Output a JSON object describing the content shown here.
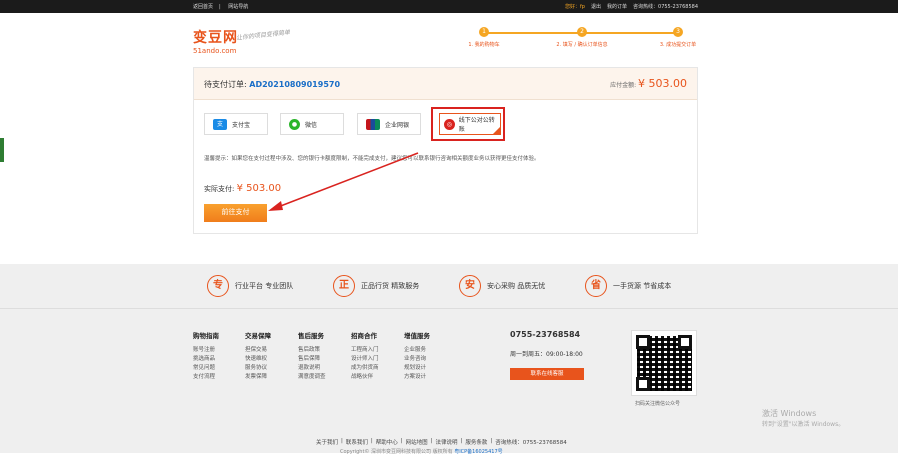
{
  "topbar": {
    "left_links": [
      "返回首页",
      "网站导航"
    ],
    "user_label": "您好：fp",
    "right_links": [
      "退出",
      "我的订单",
      "咨询热线：0755-23768584"
    ]
  },
  "logo": {
    "cn": "变豆网",
    "en": "51ando.com",
    "slogan": "让你的项目变得简单"
  },
  "steps": [
    {
      "num": "1",
      "label": "1. 我的购物车"
    },
    {
      "num": "2",
      "label": "2. 填写 / 确认订单信息"
    },
    {
      "num": "3",
      "label": "3. 成功提交订单"
    }
  ],
  "order": {
    "label": "待支付订单:",
    "order_no": "AD20210809019570",
    "amount_label": "应付金额:",
    "amount": "¥ 503.00"
  },
  "payment": {
    "methods": [
      {
        "label": "支付宝",
        "icon": "alipay-icon",
        "color": "#1a8be6"
      },
      {
        "label": "微信",
        "icon": "wechat-icon",
        "color": "#2bb52b"
      },
      {
        "label": "企业网银",
        "icon": "unionpay-icon",
        "color": "#c4161c"
      },
      {
        "label": "线下公对公转账",
        "icon": "transfer-icon",
        "color": "#d9231f"
      }
    ],
    "tip": "温馨提示：如果您在支付过程中涉及、您的银行卡额度限制，不能完成支付，建议您可以联系银行咨询相关额度业务以获得更佳支付体验。",
    "actual_label": "实际支付:",
    "actual_amount": "¥ 503.00",
    "pay_button": "前往支付"
  },
  "promos": [
    {
      "badge": "专",
      "text": "行业平台 专业团队"
    },
    {
      "badge": "正",
      "text": "正品行货 精致服务"
    },
    {
      "badge": "安",
      "text": "安心采购 品质无忧"
    },
    {
      "badge": "省",
      "text": "一手货源 节省成本"
    }
  ],
  "footer_cols": [
    {
      "title": "购物指南",
      "items": [
        "账号注册",
        "挑选商品",
        "常见问题",
        "支付流程"
      ]
    },
    {
      "title": "交易保障",
      "items": [
        "担保交易",
        "快速维权",
        "服务协议",
        "发票保障"
      ]
    },
    {
      "title": "售后服务",
      "items": [
        "售后政策",
        "售后保障",
        "退款说明",
        "满意度调查"
      ]
    },
    {
      "title": "招商合作",
      "items": [
        "工程商入门",
        "设计师入门",
        "成为供货商",
        "战略伙伴"
      ]
    },
    {
      "title": "增值服务",
      "items": [
        "企业服务",
        "业务咨询",
        "规划设计",
        "方案设计"
      ]
    }
  ],
  "contact": {
    "tel": "0755-23768584",
    "hours": "周一到周五：09:00-18:00",
    "button": "联系在线客服"
  },
  "qr_label": "扫码关注微信公众号",
  "footer_links": [
    "关于我们",
    "联系我们",
    "帮助中心",
    "网站地图",
    "法律说明",
    "服务条款",
    "咨询热线：0755-23768584"
  ],
  "copyright": {
    "text": "Copyright© 深圳市变豆网科技有限公司 版权所有 ",
    "icp": "粤ICP备16025417号"
  },
  "watermark": {
    "title": "激活 Windows",
    "sub": "转到\"设置\"以激活 Windows。"
  }
}
